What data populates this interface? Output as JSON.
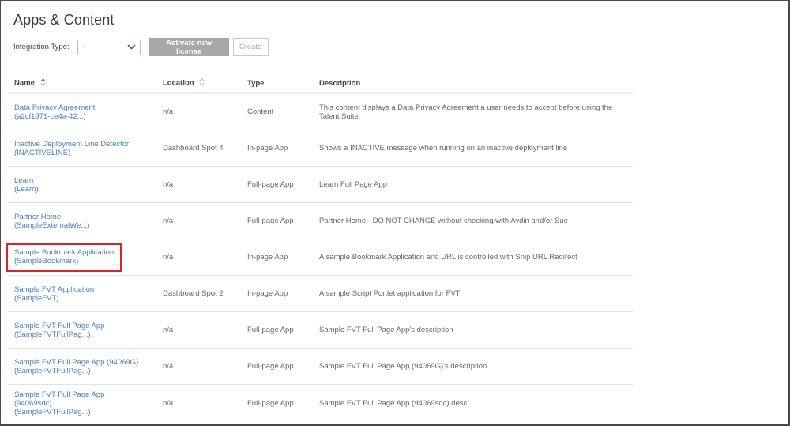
{
  "page": {
    "title": "Apps & Content"
  },
  "filters": {
    "integration_type_label": "Integration Type:",
    "integration_type_value": "-",
    "activate_button": "Activate new license",
    "create_button": "Create"
  },
  "table": {
    "columns": [
      {
        "label": "Name",
        "sortable": true,
        "sorted": "ascending"
      },
      {
        "label": "Location",
        "sortable": true,
        "sorted": "none"
      },
      {
        "label": "Type",
        "sortable": false
      },
      {
        "label": "Description",
        "sortable": false
      }
    ],
    "rows": [
      {
        "name": "Data Privacy Agreement",
        "id": "(a2cf1971-ce4a-42...)",
        "location": "n/a",
        "type": "Content",
        "description": "This content displays a Data Privacy Agreement a user needs to accept before using the Talent Suite."
      },
      {
        "name": "Inactive Deployment Line Detector",
        "id": "(INACTIVELINE)",
        "location": "Dashboard Spot 4",
        "type": "In-page App",
        "description": "Shows a INACTIVE message when running on an inactive deployment line"
      },
      {
        "name": "Learn",
        "id": "(Learn)",
        "location": "n/a",
        "type": "Full-page App",
        "description": "Learn Full Page App"
      },
      {
        "name": "Partner Home",
        "id": "(SampleExternalWe...)",
        "location": "n/a",
        "type": "Full-page App",
        "description": "Partner Home - DO NOT CHANGE without checking with Aydin and/or Sue"
      },
      {
        "name": "Sample Bookmark Application",
        "id": "(SampleBookmark)",
        "location": "n/a",
        "type": "In-page App",
        "description": "A sample Bookmark Application and URL is controlled with Snip URL Redirect",
        "highlighted": true
      },
      {
        "name": "Sample FVT Application",
        "id": "(SampleFVT)",
        "location": "Dashboard Spot 2",
        "type": "In-page App",
        "description": "A sample Script Portlet application for FVT"
      },
      {
        "name": "Sample FVT Full Page App",
        "id": "(SampleFVTFullPag...)",
        "location": "n/a",
        "type": "Full-page App",
        "description": "Sample FVT Full Page App's description"
      },
      {
        "name": "Sample FVT Full Page App (94069G)",
        "id": "(SampleFVTFullPag...)",
        "location": "n/a",
        "type": "Full-page App",
        "description": "Sample FVT Full Page App (94069G)'s description"
      },
      {
        "name": "Sample FVT Full Page App (94069sdc)",
        "id": "(SampleFVTFullPag...)",
        "location": "n/a",
        "type": "Full-page App",
        "description": "Sample FVT Full Page App (94069sdc) desc"
      }
    ]
  },
  "colors": {
    "link": "#4a7fc1",
    "highlight_border": "#d9242a",
    "primary_button_bg": "#a8a8a8",
    "sort_active": "#4a7fc1"
  }
}
